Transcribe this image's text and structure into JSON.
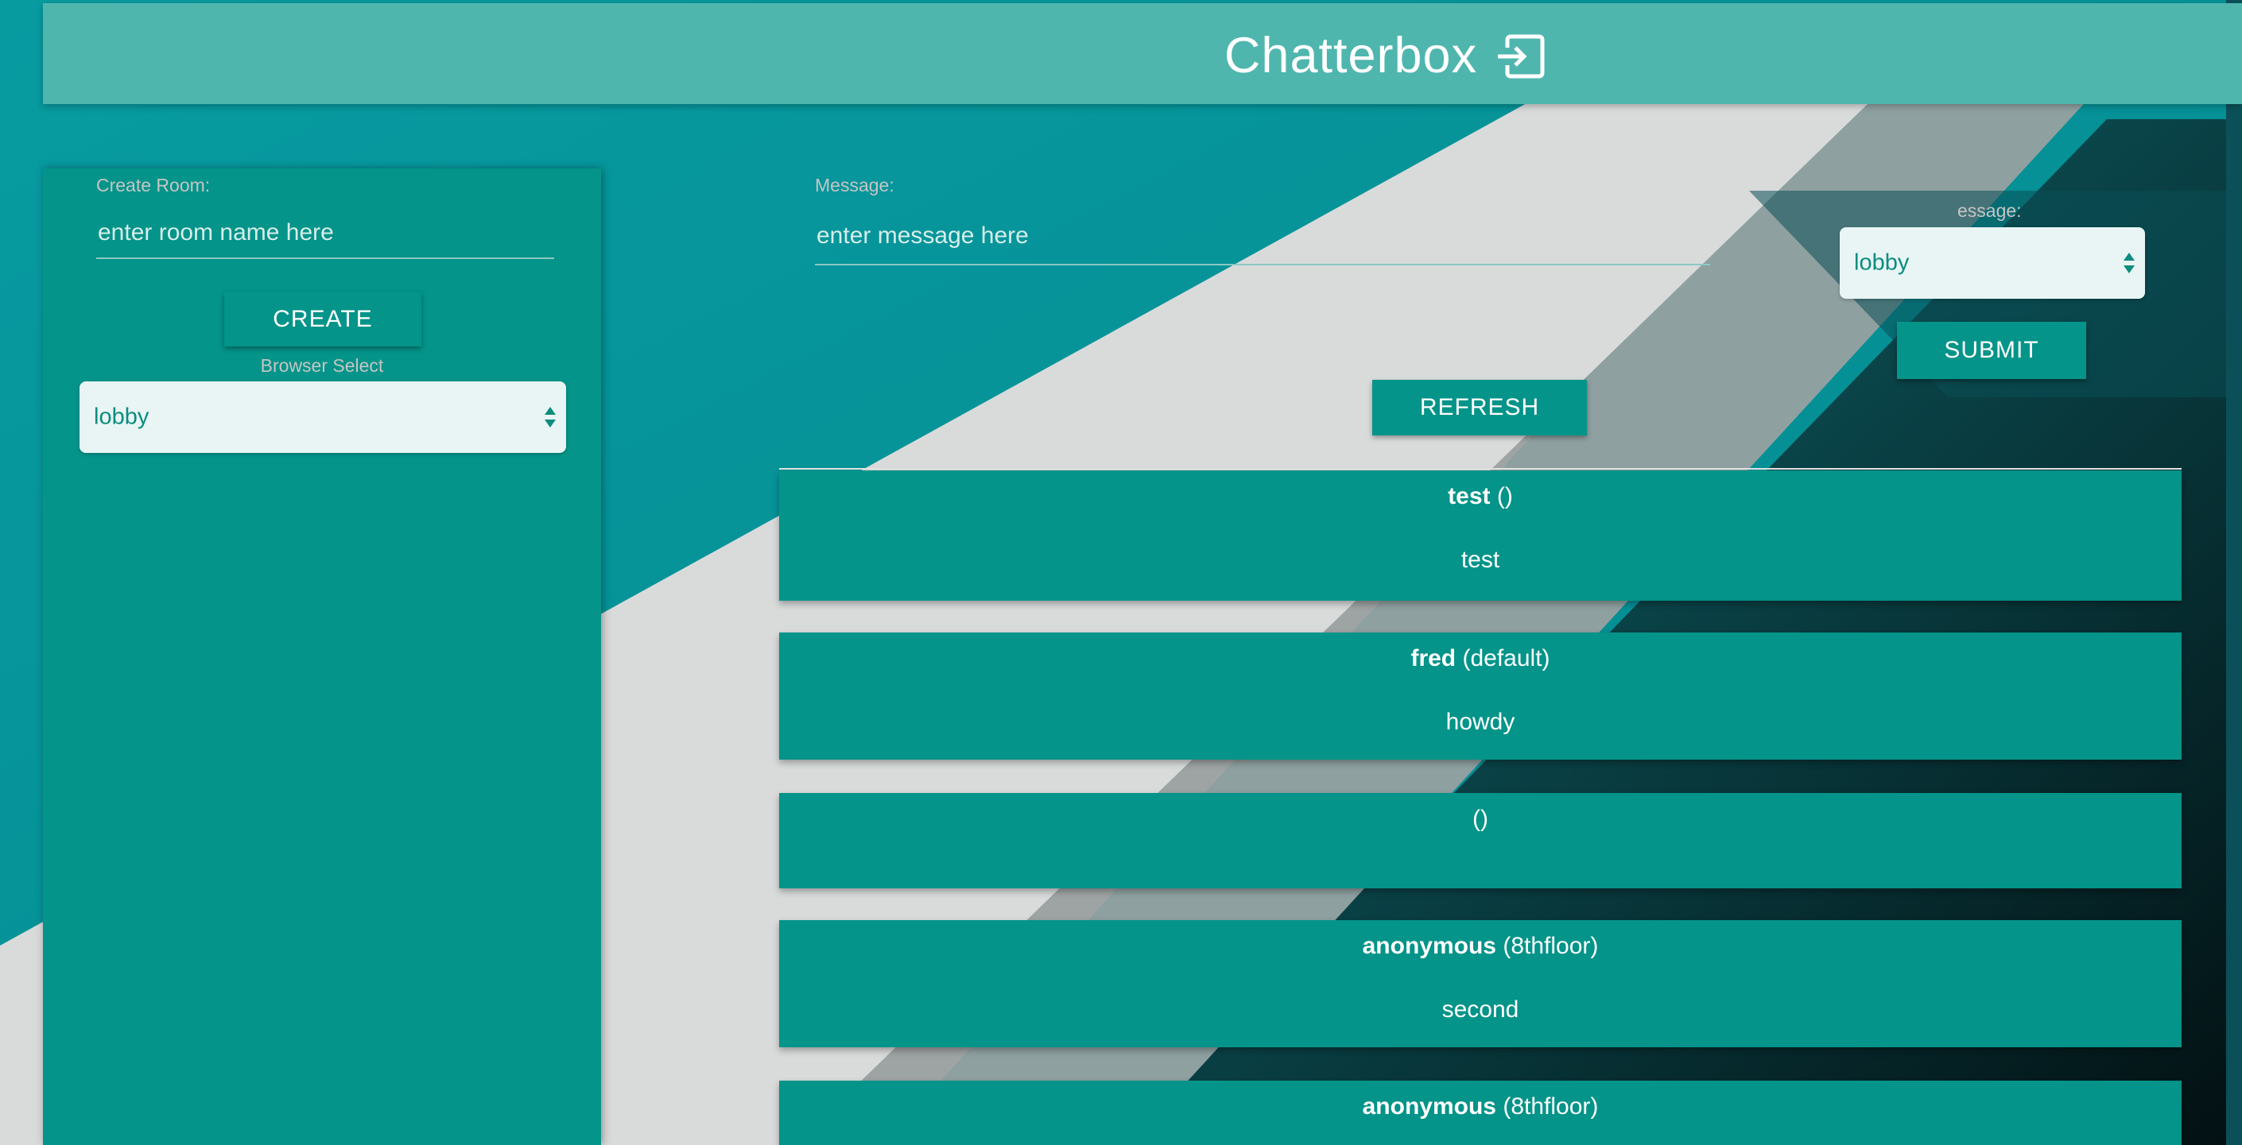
{
  "header": {
    "title": "Chatterbox",
    "logout_icon": "logout-icon"
  },
  "sidebar": {
    "create_room_label": "Create Room:",
    "room_placeholder": "enter room name here",
    "create_button": "CREATE",
    "browser_select_label": "Browser Select",
    "browser_select_value": "lobby"
  },
  "composer": {
    "message_label": "Message:",
    "message_placeholder": "enter message here",
    "room_select_label_visible": "essage:",
    "room_select_value": "lobby",
    "submit_button": "SUBMIT",
    "refresh_button": "REFRESH"
  },
  "messages": [
    {
      "user": "test",
      "room": "()",
      "text": "test"
    },
    {
      "user": "fred",
      "room": "(default)",
      "text": "howdy"
    },
    {
      "user": "",
      "room": "()",
      "text": ""
    },
    {
      "user": "anonymous",
      "room": "(8thfloor)",
      "text": "second"
    },
    {
      "user": "anonymous",
      "room": "(8thfloor)",
      "text": ""
    }
  ],
  "colors": {
    "teal": "#049489",
    "header": "#4fb6ae",
    "select_bg": "#e8f5f4"
  }
}
